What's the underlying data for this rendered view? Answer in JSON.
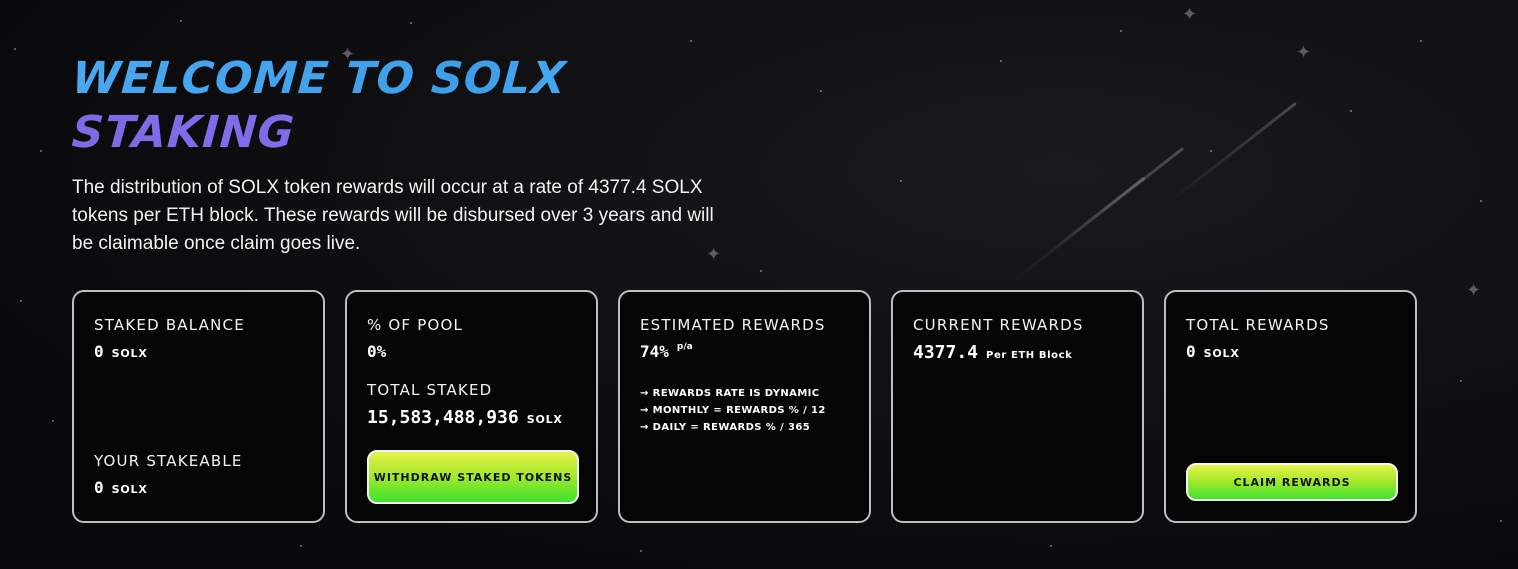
{
  "hero": {
    "title_line1": "WELCOME TO SOLX",
    "title_line2": "STAKING",
    "description": "The distribution of SOLX token rewards will occur at a rate of 4377.4 SOLX tokens per ETH block. These rewards will be disbursed over 3 years and will be claimable once claim goes live."
  },
  "cards": {
    "staked": {
      "label": "STAKED BALANCE",
      "value": "0",
      "unit": "SOLX",
      "stakeable_label": "YOUR STAKEABLE",
      "stakeable_value": "0",
      "stakeable_unit": "SOLX"
    },
    "pool": {
      "label": "% OF POOL",
      "value": "0%",
      "total_label": "TOTAL STAKED",
      "total_value": "15,583,488,936",
      "total_unit": "SOLX",
      "button": "WITHDRAW STAKED TOKENS"
    },
    "estimated": {
      "label": "ESTIMATED REWARDS",
      "value": "74%",
      "suffix": "p/a",
      "notes": [
        "→ REWARDS RATE IS DYNAMIC",
        "→ MONTHLY = REWARDS % / 12",
        "→ DAILY = REWARDS % / 365"
      ]
    },
    "current": {
      "label": "CURRENT REWARDS",
      "value": "4377.4",
      "unit": "Per ETH Block"
    },
    "total": {
      "label": "TOTAL REWARDS",
      "value": "0",
      "unit": "SOLX",
      "button": "CLAIM REWARDS"
    }
  },
  "colors": {
    "title_blue": "#4aa8f0",
    "title_purple": "#7b6be6",
    "button_green": "#3fe22e",
    "button_yellow": "#e6f24a",
    "card_border": "#bdbdc4"
  }
}
